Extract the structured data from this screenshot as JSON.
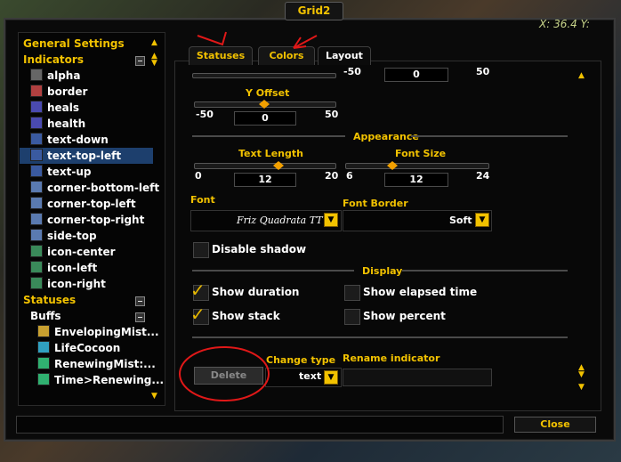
{
  "window": {
    "title": "Grid2",
    "coords": "X: 36.4  Y:"
  },
  "tree": {
    "general_settings": "General Settings",
    "indicators_header": "Indicators",
    "indicators": [
      {
        "label": "alpha",
        "icon": "alpha-icon",
        "color": "#666666"
      },
      {
        "label": "border",
        "icon": "border-icon",
        "color": "#b04040"
      },
      {
        "label": "heals",
        "icon": "heals-icon",
        "color": "#4a4ab0"
      },
      {
        "label": "health",
        "icon": "health-icon",
        "color": "#4a4ab0"
      },
      {
        "label": "text-down",
        "icon": "text-icon",
        "color": "#3a5aa0"
      },
      {
        "label": "text-top-left",
        "icon": "text-icon",
        "color": "#3a5aa0",
        "selected": true
      },
      {
        "label": "text-up",
        "icon": "text-icon",
        "color": "#3a5aa0"
      },
      {
        "label": "corner-bottom-left",
        "icon": "corner-icon",
        "color": "#5a7ab0"
      },
      {
        "label": "corner-top-left",
        "icon": "corner-icon",
        "color": "#5a7ab0"
      },
      {
        "label": "corner-top-right",
        "icon": "corner-icon",
        "color": "#5a7ab0"
      },
      {
        "label": "side-top",
        "icon": "side-icon",
        "color": "#5a7ab0"
      },
      {
        "label": "icon-center",
        "icon": "image-icon",
        "color": "#3a8a5a"
      },
      {
        "label": "icon-left",
        "icon": "image-icon",
        "color": "#3a8a5a"
      },
      {
        "label": "icon-right",
        "icon": "image-icon",
        "color": "#3a8a5a"
      }
    ],
    "statuses_header": "Statuses",
    "buffs_header": "Buffs",
    "buffs": [
      {
        "label": "EnvelopingMist...",
        "icon": "spell-icon",
        "color": "#c8a030"
      },
      {
        "label": "LifeCocoon",
        "icon": "spell-icon",
        "color": "#30a0c0"
      },
      {
        "label": "RenewingMist:...",
        "icon": "spell-icon",
        "color": "#30b070"
      },
      {
        "label": "Time>Renewing...",
        "icon": "spell-icon",
        "color": "#30b070"
      }
    ]
  },
  "tabs": [
    {
      "label": "Statuses",
      "active": false
    },
    {
      "label": "Colors",
      "active": false
    },
    {
      "label": "Layout",
      "active": true
    }
  ],
  "top_partial": {
    "min": "-50",
    "value": "0",
    "max": "50"
  },
  "y_offset": {
    "label": "Y Offset",
    "min": "-50",
    "value": "0",
    "max": "50",
    "fraction": 0.5
  },
  "appearance": {
    "header": "Appearance",
    "text_length": {
      "label": "Text Length",
      "min": "0",
      "value": "12",
      "max": "20",
      "fraction": 0.6
    },
    "font_size": {
      "label": "Font Size",
      "min": "6",
      "value": "12",
      "max": "24",
      "fraction": 0.33
    },
    "font": {
      "label": "Font",
      "value": "Friz Quadrata TT"
    },
    "font_border": {
      "label": "Font Border",
      "value": "Soft"
    },
    "disable_shadow": {
      "label": "Disable shadow",
      "checked": false
    }
  },
  "display": {
    "header": "Display",
    "show_duration": {
      "label": "Show duration",
      "checked": true
    },
    "show_stack": {
      "label": "Show stack",
      "checked": true
    },
    "show_elapsed": {
      "label": "Show elapsed time",
      "checked": false
    },
    "show_percent": {
      "label": "Show percent",
      "checked": false
    }
  },
  "bottom": {
    "delete_label": "Delete",
    "change_type_label": "Change type",
    "change_type_value": "text",
    "rename_label": "Rename indicator",
    "rename_value": ""
  },
  "close_label": "Close",
  "colors": {
    "accent": "#f2c200",
    "annotation": "#e01818",
    "selection": "#1d3f6d"
  }
}
